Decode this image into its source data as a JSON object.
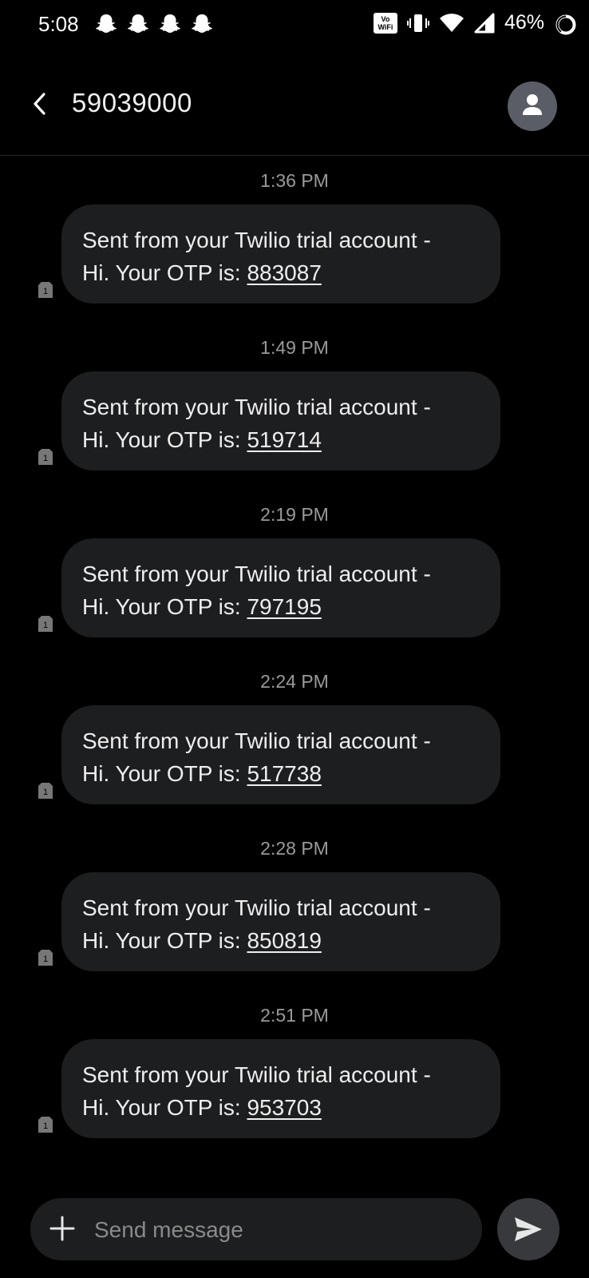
{
  "status_bar": {
    "time": "5:08",
    "notification_icons": [
      "snapchat-icon",
      "snapchat-icon",
      "snapchat-icon",
      "snapchat-icon"
    ],
    "vowifi_top": "Vo",
    "vowifi_bottom": "WiFi",
    "battery_percent": "46%"
  },
  "header": {
    "title": "59039000",
    "back_icon": "back-arrow-icon",
    "avatar_icon": "contact-avatar-icon"
  },
  "messages": [
    {
      "time": "1:36 PM",
      "text_line1": "Sent from your Twilio trial account -",
      "text_prefix": "Hi. Your OTP is: ",
      "otp": "883087",
      "sim": "1"
    },
    {
      "time": "1:49 PM",
      "text_line1": "Sent from your Twilio trial account -",
      "text_prefix": "Hi. Your OTP is: ",
      "otp": "519714",
      "sim": "1"
    },
    {
      "time": "2:19 PM",
      "text_line1": "Sent from your Twilio trial account -",
      "text_prefix": "Hi. Your OTP is: ",
      "otp": "797195",
      "sim": "1"
    },
    {
      "time": "2:24 PM",
      "text_line1": "Sent from your Twilio trial account -",
      "text_prefix": "Hi. Your OTP is: ",
      "otp": "517738",
      "sim": "1"
    },
    {
      "time": "2:28 PM",
      "text_line1": "Sent from your Twilio trial account -",
      "text_prefix": "Hi. Your OTP is: ",
      "otp": "850819",
      "sim": "1"
    },
    {
      "time": "2:51 PM",
      "text_line1": "Sent from your Twilio trial account -",
      "text_prefix": "Hi. Your OTP is: ",
      "otp": "953703",
      "sim": "1"
    }
  ],
  "composer": {
    "placeholder": "Send message",
    "value": "",
    "add_icon": "plus-icon",
    "send_icon": "send-icon"
  },
  "colors": {
    "background": "#000000",
    "bubble": "#1d1e20",
    "timestamp": "#9a9a9a",
    "avatar": "#5a5d66"
  }
}
